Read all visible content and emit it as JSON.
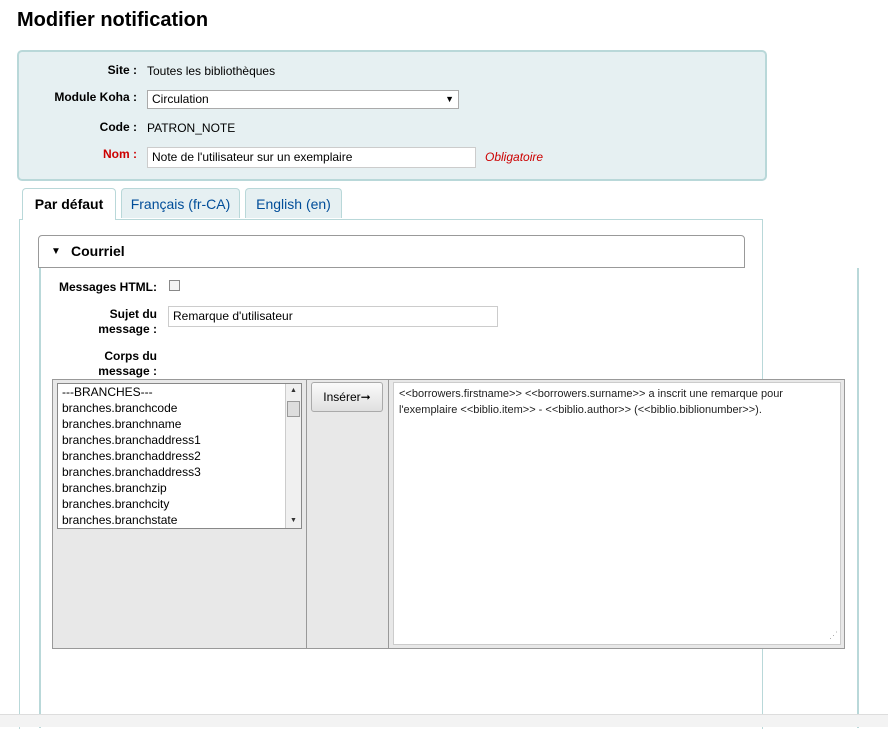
{
  "page": {
    "title": "Modifier notification"
  },
  "form": {
    "site_label": "Site :",
    "site_value": "Toutes les bibliothèques",
    "module_label": "Module Koha :",
    "module_value": "Circulation",
    "code_label": "Code :",
    "code_value": "PATRON_NOTE",
    "name_label": "Nom :",
    "name_value": "Note de l'utilisateur sur un exemplaire",
    "required_note": "Obligatoire"
  },
  "tabs": [
    {
      "label": "Par défaut",
      "active": true
    },
    {
      "label": "Français (fr-CA)",
      "active": false
    },
    {
      "label": "English (en)",
      "active": false
    }
  ],
  "section": {
    "title": "Courriel",
    "html_label": "Messages HTML:",
    "html_checked": false,
    "subject_label_1": "Sujet du",
    "subject_label_2": "message :",
    "subject_value": "Remarque d'utilisateur",
    "body_label_1": "Corps du",
    "body_label_2": "message :",
    "insert_button": "Insérer➞",
    "body_text": "<<borrowers.firstname>> <<borrowers.surname>> a inscrit une remarque pour l'exemplaire <<biblio.item>> - <<biblio.author>> (<<biblio.biblionumber>>)."
  },
  "fields_list": [
    "---BRANCHES---",
    "branches.branchcode",
    "branches.branchname",
    "branches.branchaddress1",
    "branches.branchaddress2",
    "branches.branchaddress3",
    "branches.branchzip",
    "branches.branchcity",
    "branches.branchstate"
  ],
  "icons": {
    "dropdown": "chevron-down-icon",
    "collapse": "caret-down-icon",
    "scroll_up": "scroll-up-icon",
    "scroll_down": "scroll-down-icon",
    "resize": "resize-grip-icon"
  },
  "colors": {
    "panel_bg": "#e6f0f2",
    "panel_border": "#b9d8d9",
    "required": "#cc0000",
    "tab_link": "#004d99"
  }
}
